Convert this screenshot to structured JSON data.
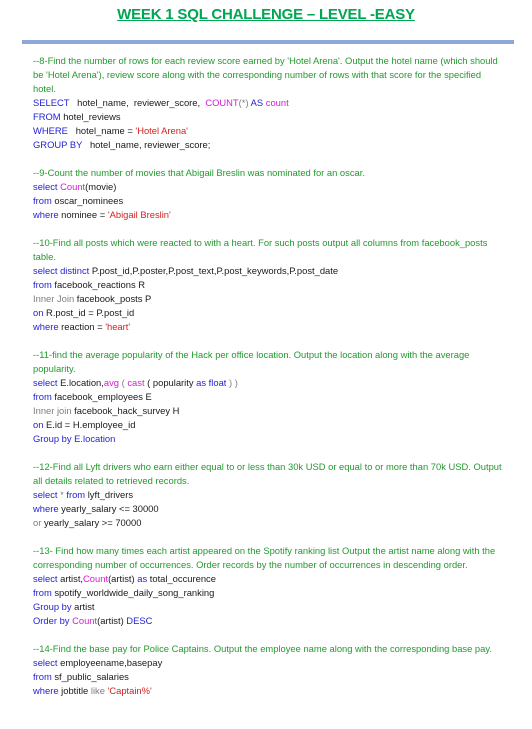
{
  "page": {
    "title": "WEEK 1 SQL CHALLENGE – LEVEL -EASY"
  },
  "blocks": [
    {
      "comment": "--8-Find the number of rows for each review score earned by 'Hotel Arena'. Output the hotel name (which should be 'Hotel Arena'), review score along with the corresponding number of rows with that score for the specified hotel.",
      "lines": [
        [
          {
            "t": "SELECT",
            "c": "kw"
          },
          {
            "t": "   hotel_name,  reviewer_score,  ",
            "c": "tx"
          },
          {
            "t": "COUNT",
            "c": "fn"
          },
          {
            "t": "(*) ",
            "c": "gray"
          },
          {
            "t": "AS",
            "c": "kw"
          },
          {
            "t": " ",
            "c": "tx"
          },
          {
            "t": "count",
            "c": "fn"
          }
        ],
        [
          {
            "t": "FROM",
            "c": "kw"
          },
          {
            "t": " hotel_reviews",
            "c": "tx"
          }
        ],
        [
          {
            "t": "WHERE",
            "c": "kw"
          },
          {
            "t": "   hotel_name = ",
            "c": "tx"
          },
          {
            "t": "'Hotel Arena'",
            "c": "str"
          }
        ],
        [
          {
            "t": "GROUP BY",
            "c": "kw"
          },
          {
            "t": "   hotel_name, reviewer_score;",
            "c": "tx"
          }
        ]
      ]
    },
    {
      "comment": "--9-Count the number of movies that Abigail Breslin was nominated for an oscar.",
      "lines": [
        [
          {
            "t": "select",
            "c": "kw"
          },
          {
            "t": " ",
            "c": "tx"
          },
          {
            "t": "Count",
            "c": "fn"
          },
          {
            "t": "(movie)",
            "c": "tx"
          }
        ],
        [
          {
            "t": "from",
            "c": "kw"
          },
          {
            "t": " oscar_nominees",
            "c": "tx"
          }
        ],
        [
          {
            "t": "where",
            "c": "kw"
          },
          {
            "t": " nominee = ",
            "c": "tx"
          },
          {
            "t": "'Abigail Breslin'",
            "c": "str"
          }
        ]
      ]
    },
    {
      "comment": "--10-Find all posts which were reacted to with a heart. For such posts output all columns from facebook_posts table.",
      "lines": [
        [
          {
            "t": "select distinct",
            "c": "kw"
          },
          {
            "t": " P.post_id,P.poster,P.post_text,P.post_keywords,P.post_date",
            "c": "tx"
          }
        ],
        [
          {
            "t": "from",
            "c": "kw"
          },
          {
            "t": " facebook_reactions R",
            "c": "tx"
          }
        ],
        [
          {
            "t": "Inner Join",
            "c": "gray"
          },
          {
            "t": " facebook_posts P",
            "c": "tx"
          }
        ],
        [
          {
            "t": "on",
            "c": "kw"
          },
          {
            "t": " R.post_id = P.post_id",
            "c": "tx"
          }
        ],
        [
          {
            "t": "where",
            "c": "kw"
          },
          {
            "t": " reaction = ",
            "c": "tx"
          },
          {
            "t": "'heart'",
            "c": "str"
          }
        ]
      ]
    },
    {
      "comment": "--11-find the average popularity of the Hack per office location. Output the location along with the average popularity.",
      "lines": [
        [
          {
            "t": "select",
            "c": "kw"
          },
          {
            "t": " E.location,",
            "c": "tx"
          },
          {
            "t": "avg",
            "c": "fn"
          },
          {
            "t": " ( ",
            "c": "gray"
          },
          {
            "t": "cast",
            "c": "fn"
          },
          {
            "t": " ( popularity ",
            "c": "tx"
          },
          {
            "t": "as float",
            "c": "kw"
          },
          {
            "t": " ) )",
            "c": "gray"
          }
        ],
        [
          {
            "t": "from",
            "c": "kw"
          },
          {
            "t": " facebook_employees E",
            "c": "tx"
          }
        ],
        [
          {
            "t": "Inner join",
            "c": "gray"
          },
          {
            "t": " facebook_hack_survey H",
            "c": "tx"
          }
        ],
        [
          {
            "t": "on",
            "c": "kw"
          },
          {
            "t": " E.id = H.employee_id",
            "c": "tx"
          }
        ],
        [
          {
            "t": "Group by",
            "c": "kw"
          },
          {
            "t": " E.location",
            "c": "kw"
          }
        ]
      ]
    },
    {
      "comment": "--12-Find all Lyft drivers who earn either equal to or less than 30k USD or equal to or more than 70k USD. Output all details related to retrieved records.",
      "lines": [
        [
          {
            "t": "select",
            "c": "kw"
          },
          {
            "t": " * ",
            "c": "gray"
          },
          {
            "t": "from",
            "c": "kw"
          },
          {
            "t": " lyft_drivers",
            "c": "tx"
          }
        ],
        [
          {
            "t": "where",
            "c": "kw"
          },
          {
            "t": " yearly_salary <= 30000",
            "c": "tx"
          }
        ],
        [
          {
            "t": "or",
            "c": "gray"
          },
          {
            "t": " yearly_salary >= 70000",
            "c": "tx"
          }
        ]
      ]
    },
    {
      "comment": "--13- Find how many times each artist appeared on the Spotify ranking list Output the artist name along with the corresponding number of occurrences. Order records by the number of occurrences in descending order.",
      "lines": [
        [
          {
            "t": "select",
            "c": "kw"
          },
          {
            "t": " artist,",
            "c": "tx"
          },
          {
            "t": "Count",
            "c": "fn"
          },
          {
            "t": "(artist) ",
            "c": "tx"
          },
          {
            "t": "as",
            "c": "kw"
          },
          {
            "t": " total_occurence",
            "c": "tx"
          }
        ],
        [
          {
            "t": "from",
            "c": "kw"
          },
          {
            "t": " spotify_worldwide_daily_song_ranking",
            "c": "tx"
          }
        ],
        [
          {
            "t": "Group by",
            "c": "kw"
          },
          {
            "t": " artist",
            "c": "tx"
          }
        ],
        [
          {
            "t": "Order by",
            "c": "kw"
          },
          {
            "t": " ",
            "c": "tx"
          },
          {
            "t": "Count",
            "c": "fn"
          },
          {
            "t": "(artist) ",
            "c": "tx"
          },
          {
            "t": "DESC",
            "c": "kw"
          }
        ]
      ]
    },
    {
      "comment": "--14-Find the base pay for Police Captains. Output the employee name along with the corresponding base pay.",
      "lines": [
        [
          {
            "t": "select",
            "c": "kw"
          },
          {
            "t": " employeename,basepay",
            "c": "tx"
          }
        ],
        [
          {
            "t": "from",
            "c": "kw"
          },
          {
            "t": " sf_public_salaries",
            "c": "tx"
          }
        ],
        [
          {
            "t": "where",
            "c": "kw"
          },
          {
            "t": " jobtitle ",
            "c": "tx"
          },
          {
            "t": "like",
            "c": "gray"
          },
          {
            "t": " ",
            "c": "tx"
          },
          {
            "t": "'Captain%'",
            "c": "str"
          }
        ]
      ]
    }
  ]
}
